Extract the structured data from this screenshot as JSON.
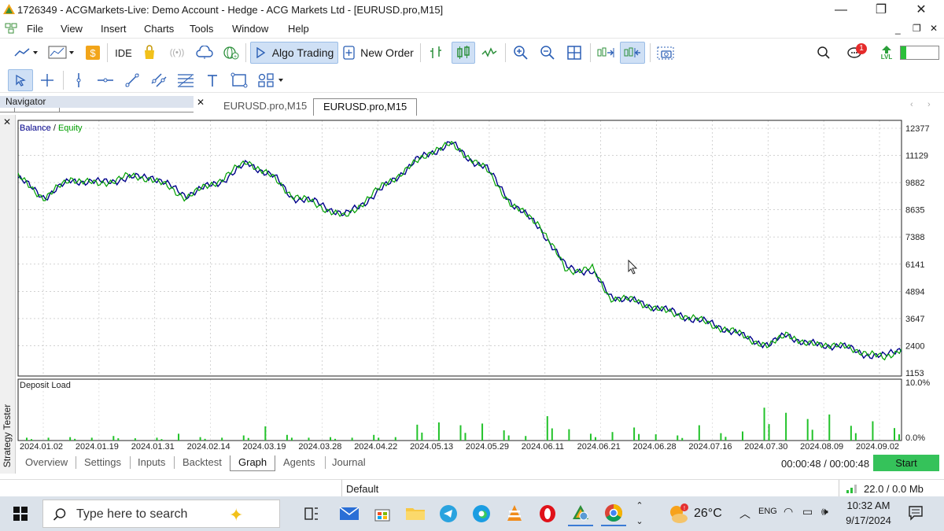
{
  "window": {
    "title": "1726349 - ACGMarkets-Live: Demo Account - Hedge - ACG Markets Ltd - [EURUSD.pro,M15]",
    "minimize": "—",
    "restore": "❐",
    "close": "✕"
  },
  "menu": [
    "File",
    "View",
    "Insert",
    "Charts",
    "Tools",
    "Window",
    "Help"
  ],
  "toolbar": {
    "ide_label": "IDE",
    "algo_trading_label": "Algo Trading",
    "new_order_label": "New Order",
    "notification_count": "1",
    "lvl_label": "LVL"
  },
  "navigator": {
    "label": "Navigator",
    "close": "✕"
  },
  "chart_tabs": [
    "EURUSD.pro,M15",
    "EURUSD.pro,M15"
  ],
  "chart": {
    "legend_balance": "Balance",
    "legend_sep": " / ",
    "legend_equity": "Equity",
    "deposit_load_label": "Deposit Load",
    "y_ticks": [
      "12377",
      "11129",
      "9882",
      "8635",
      "7388",
      "6141",
      "4894",
      "3647",
      "2400",
      "1153"
    ],
    "load_ticks": [
      "10.0%",
      "0.0%"
    ],
    "x_ticks": [
      "2024.01.02",
      "2024.01.19",
      "2024.01.31",
      "2024.02.14",
      "2024.03.19",
      "2024.03.28",
      "2024.04.22",
      "2024.05.13",
      "2024.05.29",
      "2024.06.11",
      "2024.06.21",
      "2024.06.28",
      "2024.07.16",
      "2024.07.30",
      "2024.08.09",
      "2024.09.02"
    ]
  },
  "chart_data": {
    "type": "line",
    "series": [
      {
        "name": "Balance",
        "color": "#00008b",
        "x": [
          0,
          0.03,
          0.06,
          0.09,
          0.12,
          0.15,
          0.19,
          0.23,
          0.26,
          0.29,
          0.31,
          0.34,
          0.37,
          0.4,
          0.42,
          0.45,
          0.47,
          0.49,
          0.51,
          0.53,
          0.56,
          0.59,
          0.62,
          0.65,
          0.67,
          0.7,
          0.73,
          0.76,
          0.79,
          0.82,
          0.85,
          0.87,
          0.89,
          0.91,
          0.93,
          0.96,
          0.98,
          1.0
        ],
        "values": [
          9850,
          9000,
          9750,
          9650,
          9800,
          9950,
          9100,
          9700,
          10500,
          9900,
          9000,
          8750,
          8200,
          9000,
          9600,
          10600,
          11000,
          11400,
          10700,
          10300,
          8700,
          7700,
          5950,
          5700,
          4700,
          4400,
          4100,
          3700,
          3400,
          2900,
          2500,
          3000,
          2600,
          2500,
          2500,
          2100,
          2000,
          2400
        ]
      },
      {
        "name": "Equity",
        "color": "#00a000",
        "x": [
          0,
          0.03,
          0.06,
          0.09,
          0.12,
          0.15,
          0.19,
          0.23,
          0.26,
          0.29,
          0.31,
          0.34,
          0.37,
          0.4,
          0.42,
          0.45,
          0.47,
          0.49,
          0.51,
          0.53,
          0.56,
          0.59,
          0.62,
          0.65,
          0.67,
          0.7,
          0.73,
          0.76,
          0.79,
          0.82,
          0.85,
          0.87,
          0.89,
          0.91,
          0.93,
          0.96,
          0.98,
          1.0
        ],
        "values": [
          9900,
          8950,
          9850,
          9550,
          9900,
          9850,
          9000,
          9800,
          10600,
          9800,
          9100,
          8650,
          8100,
          9100,
          9700,
          10500,
          11100,
          11300,
          10800,
          10200,
          8600,
          7850,
          5800,
          5850,
          4600,
          4450,
          4000,
          3750,
          3350,
          2950,
          2400,
          3100,
          2500,
          2600,
          2450,
          2200,
          1900,
          2400
        ]
      }
    ],
    "ylim": [
      1153,
      12377
    ],
    "deposit_load_ylim": [
      0,
      10
    ],
    "deposit_load": [
      0.5,
      0.5,
      0.6,
      0.5,
      0.8,
      0.4,
      0.5,
      1.2,
      0.6,
      0.5,
      0.9,
      2.5,
      1.0,
      0.5,
      0.6,
      0.5,
      1.0,
      0.6,
      2.8,
      3.2,
      2.7,
      3.0,
      1.8,
      0.8,
      4.3,
      2.0,
      1.2,
      1.5,
      2.3,
      1.1,
      0.9,
      2.7,
      1.3,
      1.6,
      5.8,
      4.9,
      3.8,
      4.6,
      2.6,
      3.4,
      2.2
    ]
  },
  "bottom_tabs": [
    "Overview",
    "Settings",
    "Inputs",
    "Backtest",
    "Graph",
    "Agents",
    "Journal"
  ],
  "strategy_tester_label": "Strategy Tester",
  "timer": "00:00:48 / 00:00:48",
  "start_button": "Start",
  "status": {
    "profile": "Default",
    "traffic": "22.0 / 0.0 Mb"
  },
  "taskbar": {
    "search_placeholder": "Type here to search",
    "weather": "26°C",
    "time": "10:32 AM",
    "date": "9/17/2024",
    "lang": "ENG"
  }
}
